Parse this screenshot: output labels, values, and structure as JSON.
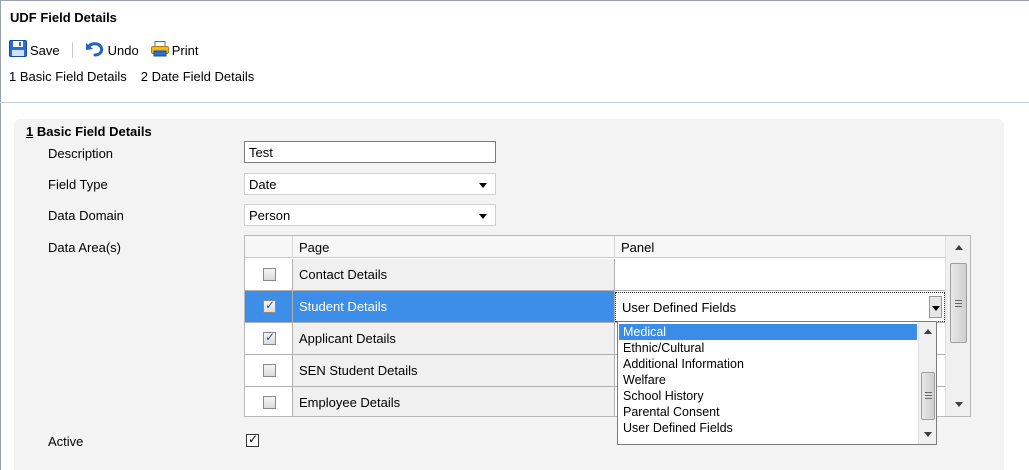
{
  "window": {
    "title": "UDF Field Details"
  },
  "toolbar": {
    "save_label": "Save",
    "undo_label": "Undo",
    "print_label": "Print"
  },
  "sections": {
    "link1": "1 Basic Field Details",
    "link2": "2 Date Field Details"
  },
  "panel": {
    "title_num": "1",
    "title_text": " Basic Field Details",
    "description_label": "Description",
    "description_value": "Test",
    "field_type_label": "Field Type",
    "field_type_value": "Date",
    "data_domain_label": "Data Domain",
    "data_domain_value": "Person",
    "data_areas_label": "Data Area(s)",
    "active_label": "Active",
    "active_checked": true
  },
  "grid": {
    "col_page": "Page",
    "col_panel": "Panel",
    "rows": [
      {
        "page": "Contact Details",
        "panel": "",
        "checked": false,
        "selected": false
      },
      {
        "page": "Student Details",
        "panel": "User Defined Fields",
        "checked": true,
        "selected": true
      },
      {
        "page": "Applicant Details",
        "panel": "",
        "checked": true,
        "selected": false
      },
      {
        "page": "SEN Student Details",
        "panel": "",
        "checked": false,
        "selected": false
      },
      {
        "page": "Employee Details",
        "panel": "",
        "checked": false,
        "selected": false
      }
    ]
  },
  "panel_dropdown": {
    "selected_value": "User Defined Fields",
    "options": [
      "Medical",
      "Ethnic/Cultural",
      "Additional Information",
      "Welfare",
      "School History",
      "Parental Consent",
      "User Defined Fields"
    ],
    "highlighted": "Medical"
  },
  "colors": {
    "selection": "#3d8ee8",
    "panel_bg": "#f3f3f3"
  },
  "icons": {
    "save": "floppy-disk-icon",
    "undo": "undo-arrow-icon",
    "print": "printer-icon"
  }
}
